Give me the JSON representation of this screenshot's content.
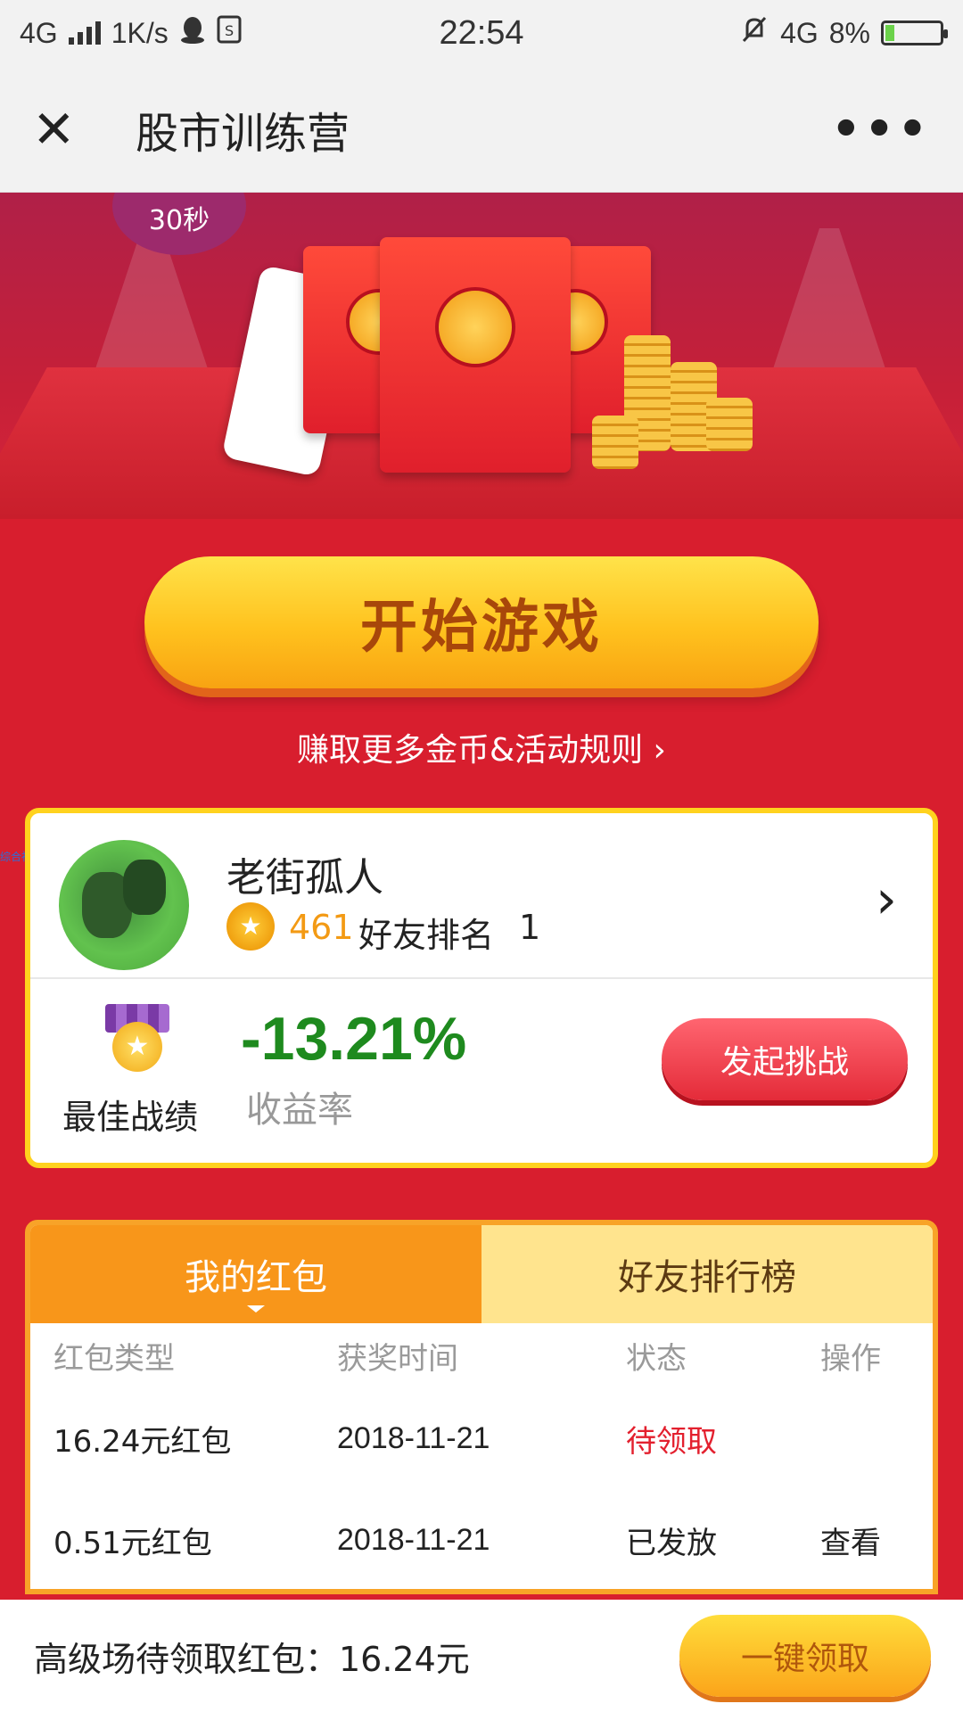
{
  "status_bar": {
    "network": "4G",
    "speed": "1K/s",
    "time": "22:54",
    "network_right": "4G",
    "battery": "8%"
  },
  "nav": {
    "title": "股市训练营",
    "close_glyph": "✕",
    "more_glyph": "•••"
  },
  "banner": {
    "timer_badge": "30秒"
  },
  "start_button": "开始游戏",
  "rules_link": "赚取更多金币&活动规则 ›",
  "side_tag": "综合社区",
  "profile": {
    "name": "老街孤人",
    "coins": "461",
    "rank_label": "好友排名",
    "rank": "1",
    "best_label": "最佳战绩",
    "return_value": "-13.21%",
    "return_label": "收益率",
    "challenge_button": "发起挑战"
  },
  "tabs": [
    {
      "label": "我的红包",
      "active": true
    },
    {
      "label": "好友排行榜",
      "active": false
    }
  ],
  "table": {
    "headers": [
      "红包类型",
      "获奖时间",
      "状态",
      "操作"
    ],
    "rows": [
      {
        "type": "16.24元红包",
        "time": "2018-11-21",
        "status": "待领取",
        "action": ""
      },
      {
        "type": "0.51元红包",
        "time": "2018-11-21",
        "status": "已发放",
        "action": "查看"
      }
    ]
  },
  "bottom_bar": {
    "claim_text": "高级场待领取红包：16.24元",
    "claim_button": "一键领取"
  },
  "colors": {
    "page_red": "#d81e2e",
    "gold": "#ffc21e",
    "return_green": "#1e8a1e",
    "pending_red": "#e3202e"
  }
}
